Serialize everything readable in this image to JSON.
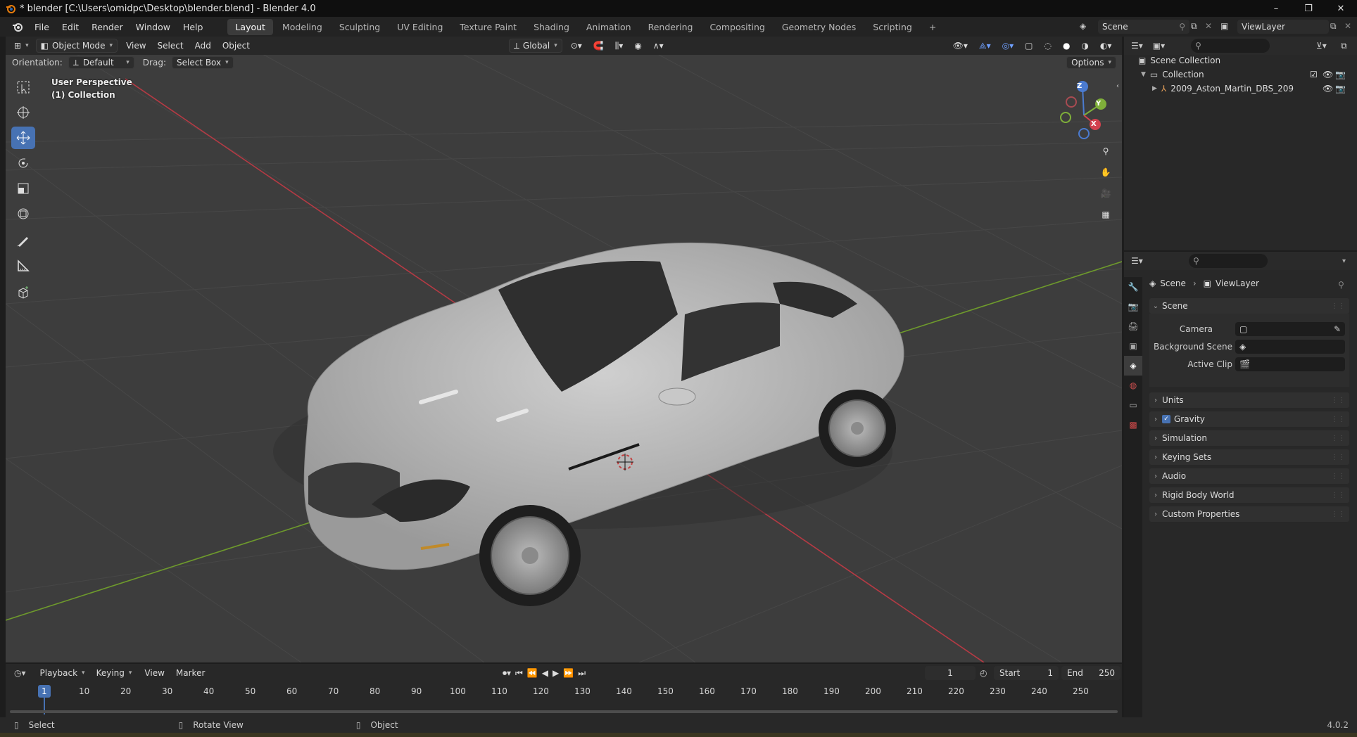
{
  "window": {
    "title": "* blender [C:\\Users\\omidpc\\Desktop\\blender.blend] - Blender 4.0",
    "minimize": "–",
    "maximize": "❐",
    "close": "✕"
  },
  "menubar": {
    "items": [
      "File",
      "Edit",
      "Render",
      "Window",
      "Help"
    ]
  },
  "workspaces": {
    "tabs": [
      "Layout",
      "Modeling",
      "Sculpting",
      "UV Editing",
      "Texture Paint",
      "Shading",
      "Animation",
      "Rendering",
      "Compositing",
      "Geometry Nodes",
      "Scripting"
    ],
    "active": "Layout",
    "add": "+"
  },
  "scene_selector": {
    "scene": "Scene",
    "view_layer": "ViewLayer"
  },
  "viewport_header": {
    "mode": "Object Mode",
    "menus": [
      "View",
      "Select",
      "Add",
      "Object"
    ],
    "transform_orientation": "Global",
    "options": "Options"
  },
  "tool_settings": {
    "orientation_label": "Orientation:",
    "orientation_value": "Default",
    "drag_label": "Drag:",
    "drag_value": "Select Box"
  },
  "viewport": {
    "perspective": "User Perspective",
    "collection": "(1) Collection",
    "gizmo": {
      "x": "X",
      "y": "Y",
      "z": "Z"
    },
    "colors": {
      "background": "#3d3d3d",
      "x_axis": "#c2404a",
      "y_axis": "#6e9a2c",
      "active_tool": "#4772b3"
    }
  },
  "toolbar": {
    "tools": [
      "select-box",
      "cursor",
      "move",
      "rotate",
      "scale",
      "transform",
      "annotate",
      "measure",
      "add-cube"
    ],
    "active": "move"
  },
  "outliner": {
    "root": "Scene Collection",
    "collection": "Collection",
    "object": "2009_Aston_Martin_DBS_209"
  },
  "properties": {
    "breadcrumb": [
      "Scene",
      "ViewLayer"
    ],
    "scene_panel": "Scene",
    "fields": [
      {
        "label": "Camera"
      },
      {
        "label": "Background Scene"
      },
      {
        "label": "Active Clip"
      }
    ],
    "panels": [
      "Units",
      "Gravity",
      "Simulation",
      "Keying Sets",
      "Audio",
      "Rigid Body World",
      "Custom Properties"
    ],
    "gravity_checked": true
  },
  "timeline": {
    "menus": [
      "Playback",
      "Keying",
      "View",
      "Marker"
    ],
    "current_frame": "1",
    "start_label": "Start",
    "start": "1",
    "end_label": "End",
    "end": "250",
    "ticks": [
      "1",
      "10",
      "20",
      "30",
      "40",
      "50",
      "60",
      "70",
      "80",
      "90",
      "100",
      "110",
      "120",
      "130",
      "140",
      "150",
      "160",
      "170",
      "180",
      "190",
      "200",
      "210",
      "220",
      "230",
      "240",
      "250"
    ]
  },
  "statusbar": {
    "select": "Select",
    "rotate": "Rotate View",
    "object": "Object",
    "version": "4.0.2"
  }
}
